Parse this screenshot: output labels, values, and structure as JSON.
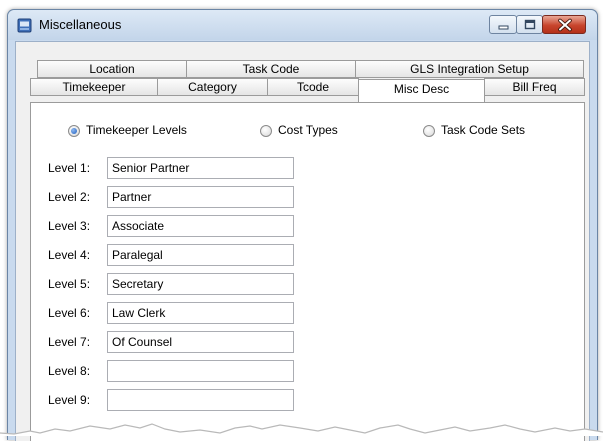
{
  "window": {
    "title": "Miscellaneous"
  },
  "tabs": {
    "back_row": [
      "Location",
      "Task Code",
      "GLS Integration Setup"
    ],
    "front_row": [
      "Timekeeper",
      "Category",
      "Tcode",
      "Misc Desc",
      "Bill Freq"
    ],
    "active": "Misc Desc"
  },
  "options": {
    "selected": "Timekeeper Levels",
    "items": [
      "Timekeeper Levels",
      "Cost Types",
      "Task Code Sets"
    ]
  },
  "levels": [
    {
      "label": "Level 1:",
      "value": "Senior Partner"
    },
    {
      "label": "Level 2:",
      "value": "Partner"
    },
    {
      "label": "Level 3:",
      "value": "Associate"
    },
    {
      "label": "Level 4:",
      "value": "Paralegal"
    },
    {
      "label": "Level 5:",
      "value": "Secretary"
    },
    {
      "label": "Level 6:",
      "value": "Law Clerk"
    },
    {
      "label": "Level 7:",
      "value": "Of Counsel"
    },
    {
      "label": "Level 8:",
      "value": ""
    },
    {
      "label": "Level 9:",
      "value": ""
    }
  ],
  "colors": {
    "frame": "#c9daee",
    "client": "#f0f0f0",
    "close_button": "#c8452d",
    "radio_selected": "#1f5fbf"
  },
  "icons": {
    "app": "app-window-icon",
    "minimize": "minimize-icon",
    "maximize": "maximize-icon",
    "close": "close-icon"
  }
}
